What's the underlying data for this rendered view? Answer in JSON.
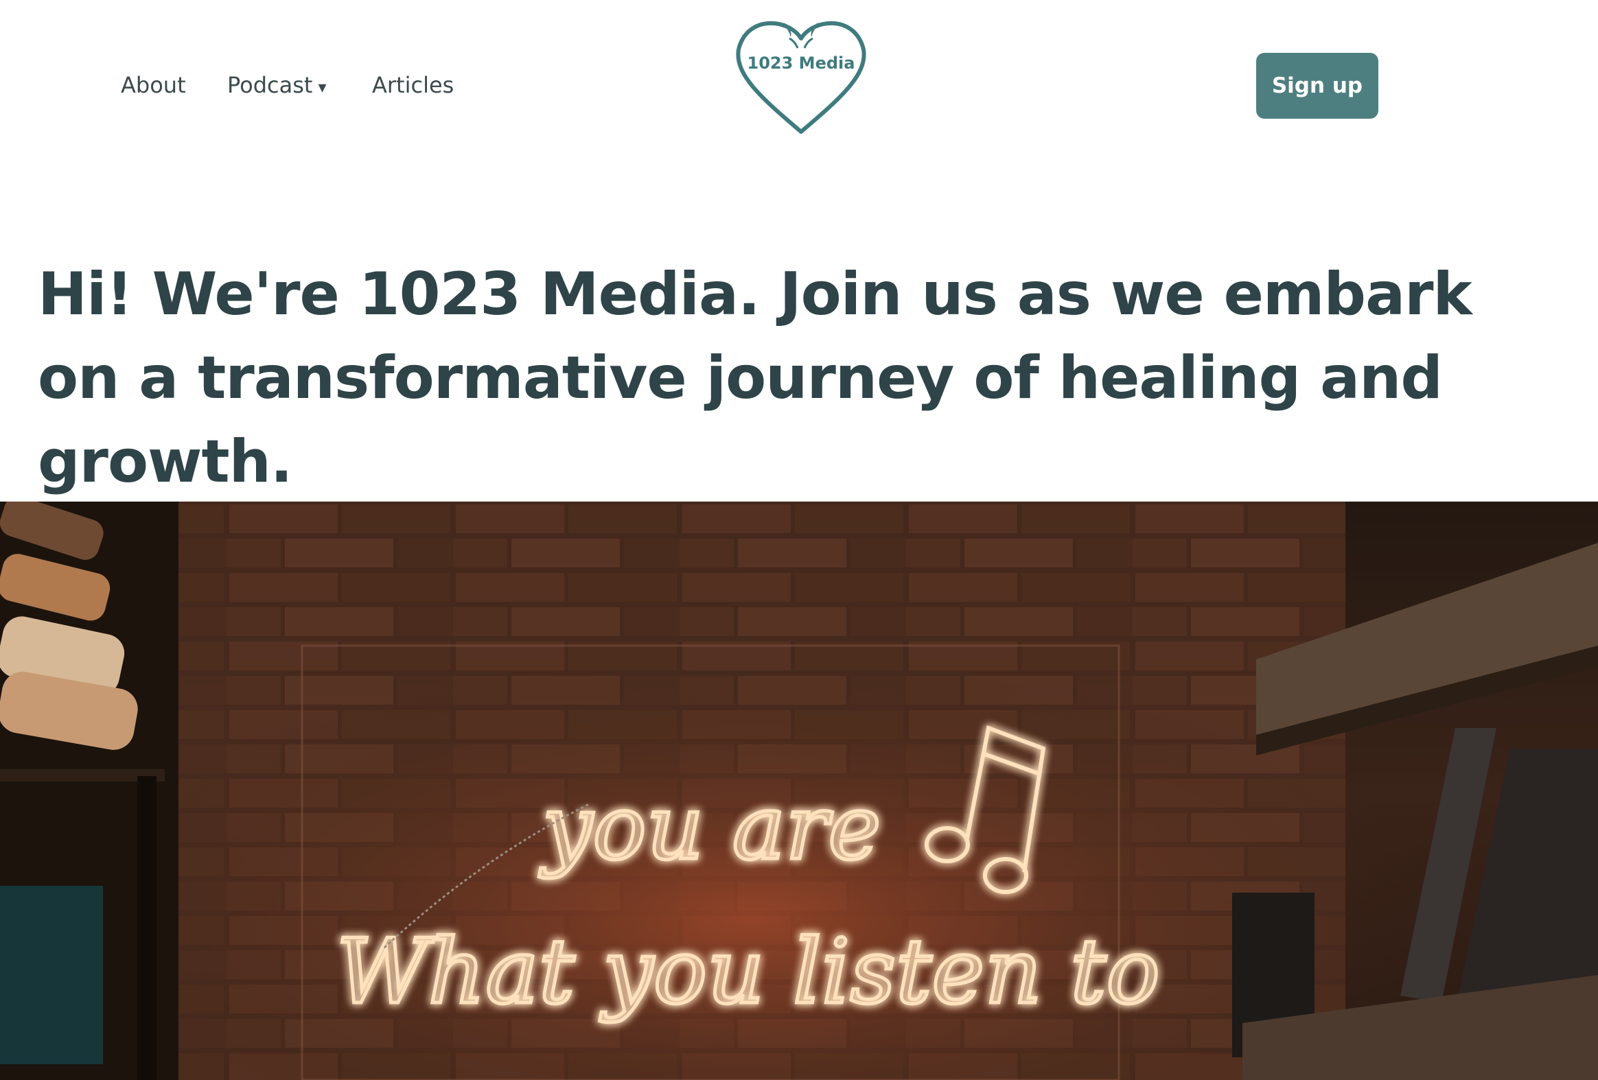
{
  "nav": {
    "about": "About",
    "podcast": "Podcast",
    "podcast_caret": "▾",
    "articles": "Articles"
  },
  "logo": {
    "text": "1023 Media",
    "icon": "heart-logo",
    "color": "#3f7b7f"
  },
  "signup": {
    "label": "Sign up"
  },
  "hero": {
    "headline": "Hi! We're 1023 Media. Join us as we embark on a transformative journey of healing and growth.",
    "image": {
      "description_icon": "neon-sign-photo",
      "neon_line1": "you are",
      "neon_line2": "What you listen to",
      "neon_color": "#ffd9a8",
      "glow_color": "#ff7a3a"
    }
  },
  "colors": {
    "accent": "#4e7f80",
    "heading": "#2f4448",
    "nav_text": "#3c4a4d"
  }
}
